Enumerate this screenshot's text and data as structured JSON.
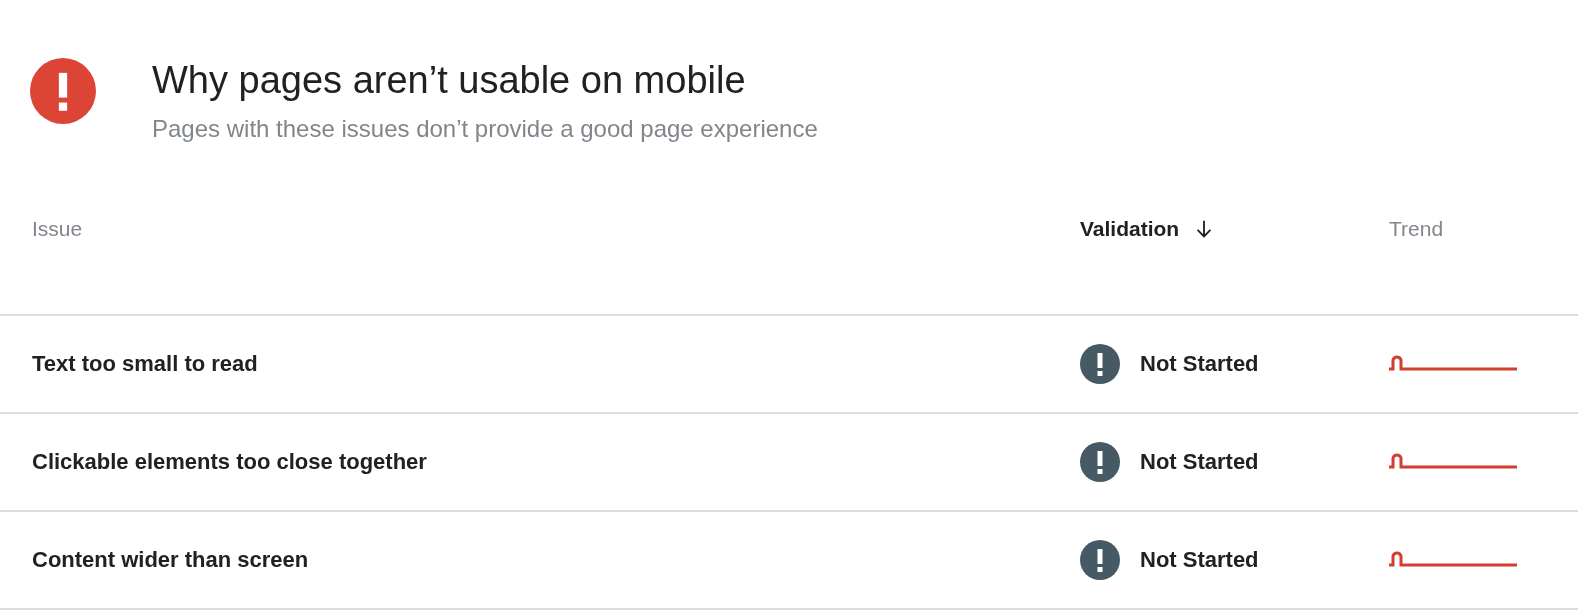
{
  "header": {
    "title": "Why pages aren’t usable on mobile",
    "subtitle": "Pages with these issues don’t provide a good page experience"
  },
  "table": {
    "columns": [
      {
        "label": "Issue",
        "sorted": false
      },
      {
        "label": "Validation",
        "sorted": true
      },
      {
        "label": "Trend",
        "sorted": false
      }
    ],
    "rows": [
      {
        "issue": "Text too small to read",
        "validation": "Not Started"
      },
      {
        "issue": "Clickable elements too close together",
        "validation": "Not Started"
      },
      {
        "issue": "Content wider than screen",
        "validation": "Not Started"
      }
    ]
  }
}
